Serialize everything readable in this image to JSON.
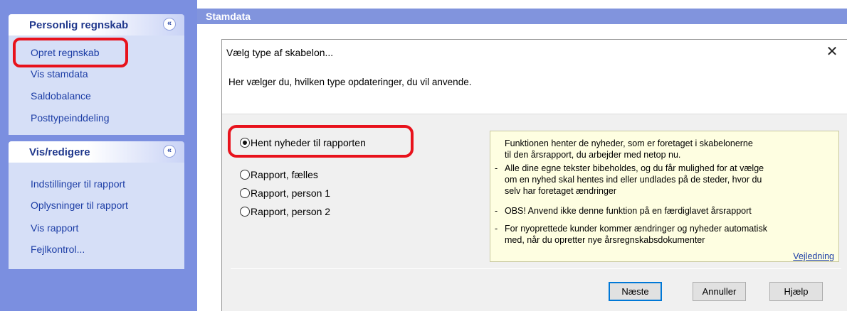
{
  "sidebar": {
    "groups": [
      {
        "title": "Personlig regnskab",
        "items": [
          "Opret regnskab",
          "Vis stamdata",
          "Saldobalance",
          "Posttypeinddeling"
        ]
      },
      {
        "title": "Vis/redigere",
        "items": [
          "Indstillinger til rapport",
          "Oplysninger til rapport",
          "Vis rapport",
          "Fejlkontrol..."
        ]
      }
    ],
    "collapse_glyph": "«",
    "colors": {
      "panel": "#7b8fe0",
      "group_body": "#d6dff7",
      "link": "#1d3ea6",
      "title": "#21398d"
    }
  },
  "main": {
    "header_title": "Stamdata"
  },
  "dialog": {
    "title": "Vælg type af skabelon...",
    "close_glyph": "✕",
    "subtitle": "Her vælger du, hvilken type opdateringer, du vil anvende.",
    "options": [
      {
        "label": "Hent nyheder til rapporten",
        "checked": true
      },
      {
        "label": "Rapport, fælles",
        "checked": false
      },
      {
        "label": "Rapport, person 1",
        "checked": false
      },
      {
        "label": "Rapport, person 2",
        "checked": false
      }
    ],
    "info": {
      "line1": "Funktionen henter de nyheder, som er foretaget i skabelonerne",
      "line2": "til den årsrapport, du arbejder med netop nu.",
      "bullets": [
        {
          "lines": [
            "Alle dine egne tekster bibeholdes, og du får mulighed for at vælge",
            "om en nyhed skal hentes ind eller undlades på de steder, hvor du",
            "selv har foretaget ændringer"
          ]
        },
        {
          "lines": [
            "OBS! Anvend ikke denne funktion på en færdiglavet årsrapport"
          ]
        },
        {
          "lines": [
            "For nyoprettede kunder kommer ændringer og nyheder automatisk",
            "med, når du opretter nye årsregnskabsdokumenter"
          ]
        }
      ],
      "dash": "-",
      "link": "Vejledning"
    },
    "buttons": {
      "next": "Næste",
      "cancel": "Annuller",
      "help": "Hjælp"
    }
  },
  "annotation_color": "#e8121c"
}
